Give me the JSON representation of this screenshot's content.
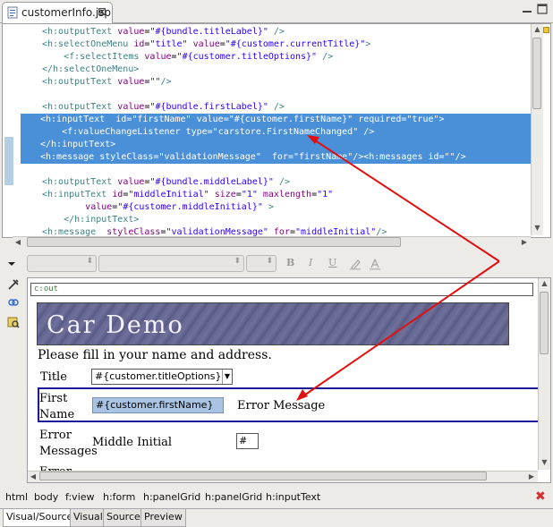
{
  "editor_tab": {
    "label": "customerInfo.jsp",
    "close_glyph": "⊠"
  },
  "source_lines": [
    {
      "indent": "",
      "parts": [
        [
          "tag",
          "<h:outputText "
        ],
        [
          "attr",
          "value"
        ],
        [
          "txt",
          "="
        ],
        [
          "val",
          "\"#{bundle.titleLabel}\""
        ],
        [
          "tag",
          " />"
        ]
      ]
    },
    {
      "indent": "",
      "parts": [
        [
          "tag",
          "<h:selectOneMenu "
        ],
        [
          "attr",
          "id"
        ],
        [
          "txt",
          "="
        ],
        [
          "val",
          "\"title\""
        ],
        [
          "attr",
          " value"
        ],
        [
          "txt",
          "="
        ],
        [
          "val",
          "\"#{customer.currentTitle}\""
        ],
        [
          "tag",
          ">"
        ]
      ]
    },
    {
      "indent": "    ",
      "parts": [
        [
          "tag",
          "<f:selectItems "
        ],
        [
          "attr",
          "value"
        ],
        [
          "txt",
          "="
        ],
        [
          "val",
          "\"#{customer.titleOptions}\""
        ],
        [
          "tag",
          " />"
        ]
      ]
    },
    {
      "indent": "",
      "parts": [
        [
          "tag",
          "</h:selectOneMenu>"
        ]
      ]
    },
    {
      "indent": "",
      "parts": [
        [
          "tag",
          "<h:outputText "
        ],
        [
          "attr",
          "value"
        ],
        [
          "txt",
          "="
        ],
        [
          "val",
          "\"\""
        ],
        [
          "tag",
          "/>"
        ]
      ]
    },
    {
      "indent": "",
      "parts": []
    },
    {
      "indent": "",
      "parts": [
        [
          "tag",
          "<h:outputText "
        ],
        [
          "attr",
          "value"
        ],
        [
          "txt",
          "="
        ],
        [
          "val",
          "\"#{bundle.firstLabel}\""
        ],
        [
          "tag",
          " />"
        ]
      ]
    },
    {
      "indent": "",
      "selected": true,
      "parts": [
        [
          "sel",
          "<h:inputText  id=\"firstName\" value=\"#{customer.firstName}\" required=\"true\">"
        ]
      ]
    },
    {
      "indent": "    ",
      "selected": true,
      "parts": [
        [
          "sel",
          "<f:valueChangeListener type=\"carstore.FirstNameChanged\" />"
        ]
      ]
    },
    {
      "indent": "",
      "selected": true,
      "parts": [
        [
          "sel",
          "</h:inputText>"
        ]
      ]
    },
    {
      "indent": "",
      "selected": true,
      "parts": [
        [
          "sel",
          "<h:message "
        ],
        [
          "sel",
          "styleClass=\"validationMessage\"  for=\""
        ],
        [
          "sel",
          "firstName"
        ],
        [
          "sel",
          "\"/><h:messages id=\"\"/>"
        ]
      ]
    },
    {
      "indent": "",
      "parts": []
    },
    {
      "indent": "",
      "parts": [
        [
          "tag",
          "<h:outputText "
        ],
        [
          "attr",
          "value"
        ],
        [
          "txt",
          "="
        ],
        [
          "val",
          "\"#{bundle.middleLabel}\""
        ],
        [
          "tag",
          " />"
        ]
      ]
    },
    {
      "indent": "",
      "parts": [
        [
          "tag",
          "<h:inputText "
        ],
        [
          "attr",
          "id"
        ],
        [
          "txt",
          "="
        ],
        [
          "val",
          "\"middleInitial\""
        ],
        [
          "attr",
          " size"
        ],
        [
          "txt",
          "="
        ],
        [
          "val",
          "\"1\""
        ],
        [
          "attr",
          " maxlength"
        ],
        [
          "txt",
          "="
        ],
        [
          "val",
          "\"1\""
        ]
      ]
    },
    {
      "indent": "        ",
      "parts": [
        [
          "attr",
          "value"
        ],
        [
          "txt",
          "="
        ],
        [
          "val",
          "\"#{customer.middleInitial}\""
        ],
        [
          "tag",
          " >"
        ]
      ]
    },
    {
      "indent": "    ",
      "parts": [
        [
          "tag",
          "</h:inputText>"
        ]
      ]
    },
    {
      "indent": "",
      "parts": [
        [
          "tag",
          "<h:message  "
        ],
        [
          "attr",
          "styleClass"
        ],
        [
          "txt",
          "="
        ],
        [
          "val",
          "\"validationMessage\""
        ],
        [
          "attr",
          " for"
        ],
        [
          "txt",
          "="
        ],
        [
          "val",
          "\"middleInitial\""
        ],
        [
          "tag",
          "/>"
        ]
      ]
    }
  ],
  "format_toolbar": {
    "bold": "B",
    "italic": "I",
    "underline": "U"
  },
  "visual": {
    "cout_label": "c:out",
    "banner_text": "Car Demo",
    "instructions": "Please fill in your name and address.",
    "title_label": "Title",
    "title_select_value": "#{customer.titleOptions}",
    "first_label_line1": "First",
    "first_label_line2": "Name",
    "first_input_value": "#{customer.firstName}",
    "error_message": "Error Message",
    "errors_label_line1": "Error",
    "errors_label_line2": "Messages",
    "middle_label": "Middle Initial",
    "middle_input_value": "#{c",
    "error_partial": "Error"
  },
  "breadcrumbs": [
    "html",
    "body",
    "f:view",
    "h:form",
    "h:panelGrid",
    "h:panelGrid",
    "h:inputText"
  ],
  "bottom_tabs": [
    {
      "label": "Visual/Source",
      "active": true
    },
    {
      "label": "Visual",
      "active": false
    },
    {
      "label": "Source",
      "active": false
    },
    {
      "label": "Preview",
      "active": false
    }
  ],
  "colors": {
    "selection": "#4a90d9",
    "annotation_arrow": "#e01010",
    "banner": "#5b5d8c"
  }
}
